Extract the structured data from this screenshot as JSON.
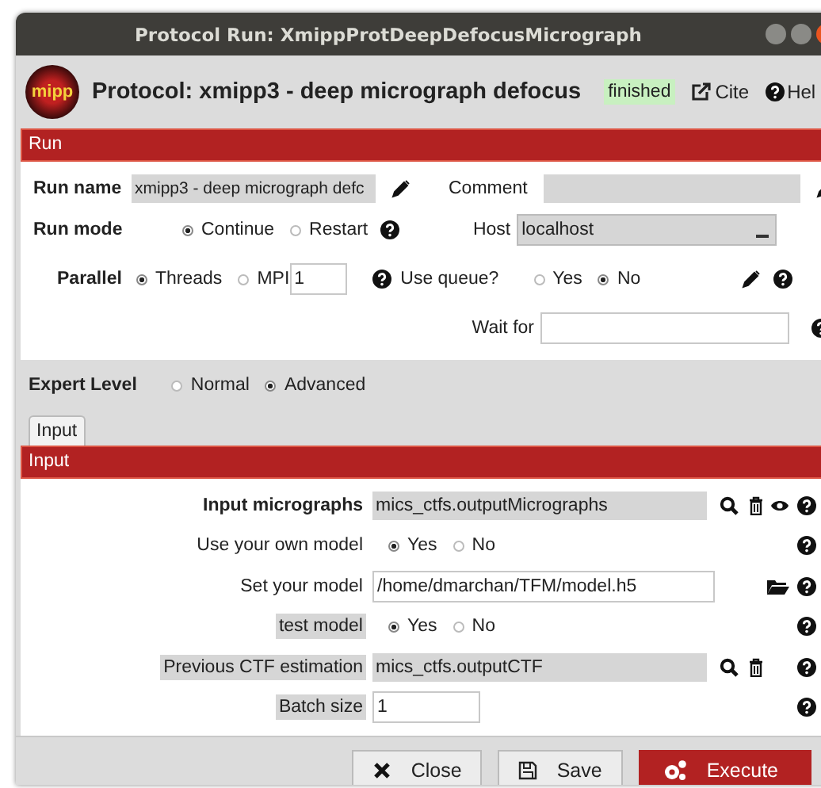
{
  "window": {
    "title": "Protocol Run: XmippProtDeepDefocusMicrograph"
  },
  "header": {
    "logo": "mipp",
    "title": "Protocol: xmipp3 - deep micrograph defocus",
    "status": "finished",
    "cite": "Cite",
    "help": "Hel"
  },
  "run_section": {
    "title": "Run",
    "run_name": {
      "label": "Run name",
      "value": "xmipp3 - deep micrograph defc"
    },
    "comment": {
      "label": "Comment"
    },
    "run_mode": {
      "label": "Run mode",
      "options": [
        {
          "label": "Continue",
          "selected": true
        },
        {
          "label": "Restart",
          "selected": false
        }
      ]
    },
    "host": {
      "label": "Host",
      "value": "localhost"
    },
    "parallel": {
      "label": "Parallel",
      "options": [
        {
          "label": "Threads",
          "selected": true
        },
        {
          "label": "MPI",
          "selected": false
        }
      ],
      "value": "1"
    },
    "use_queue": {
      "label": "Use queue?",
      "options": [
        {
          "label": "Yes",
          "selected": false
        },
        {
          "label": "No",
          "selected": true
        }
      ]
    },
    "wait_for": {
      "label": "Wait for"
    }
  },
  "expert_level": {
    "label": "Expert Level",
    "options": [
      {
        "label": "Normal",
        "selected": false
      },
      {
        "label": "Advanced",
        "selected": true
      }
    ]
  },
  "tabs": [
    {
      "label": "Input",
      "selected": true
    }
  ],
  "input_section": {
    "title": "Input",
    "params": [
      {
        "kind": "pointer",
        "label": "Input micrographs",
        "value": "mics_ctfs.outputMicrographs",
        "important": true,
        "highlighted": false,
        "viewable": true
      },
      {
        "kind": "radio",
        "label": "Use your own model",
        "options": [
          {
            "label": "Yes",
            "selected": true
          },
          {
            "label": "No",
            "selected": false
          }
        ],
        "important": false,
        "highlighted": false
      },
      {
        "kind": "path",
        "label": "Set your model",
        "value": "/home/dmarchan/TFM/model.h5",
        "important": false,
        "highlighted": false
      },
      {
        "kind": "radio",
        "label": "test model",
        "options": [
          {
            "label": "Yes",
            "selected": true
          },
          {
            "label": "No",
            "selected": false
          }
        ],
        "important": false,
        "highlighted": true
      },
      {
        "kind": "pointer",
        "label": "Previous CTF estimation",
        "value": "mics_ctfs.outputCTF",
        "important": false,
        "highlighted": true,
        "viewable": false
      },
      {
        "kind": "text",
        "label": "Batch size",
        "value": "1",
        "important": false,
        "highlighted": true
      }
    ]
  },
  "buttons": [
    {
      "label": "Close",
      "kind": "close"
    },
    {
      "label": "Save",
      "kind": "save"
    },
    {
      "label": "Execute",
      "kind": "execute"
    }
  ]
}
